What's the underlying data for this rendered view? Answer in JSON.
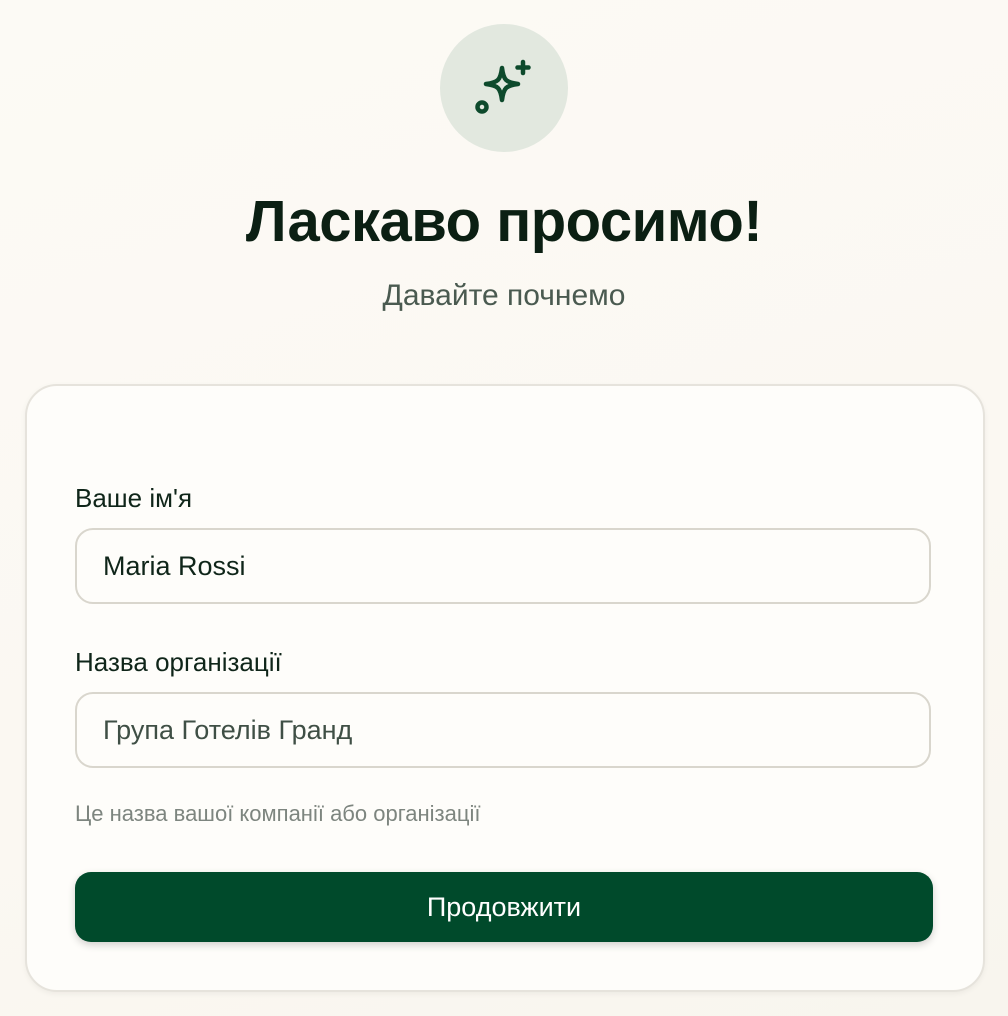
{
  "header": {
    "icon": "sparkles-icon",
    "title": "Ласкаво просимо!",
    "subtitle": "Давайте почнемо"
  },
  "form": {
    "name_label": "Ваше ім'я",
    "name_value": "Maria Rossi",
    "org_label": "Назва організації",
    "org_value": "Група Готелів Гранд",
    "org_helper": "Це назва вашої компанії або організації",
    "submit_label": "Продовжити"
  },
  "colors": {
    "accent": "#004a2b",
    "icon_bg": "#e2e8df",
    "background": "#fbf9f4"
  }
}
